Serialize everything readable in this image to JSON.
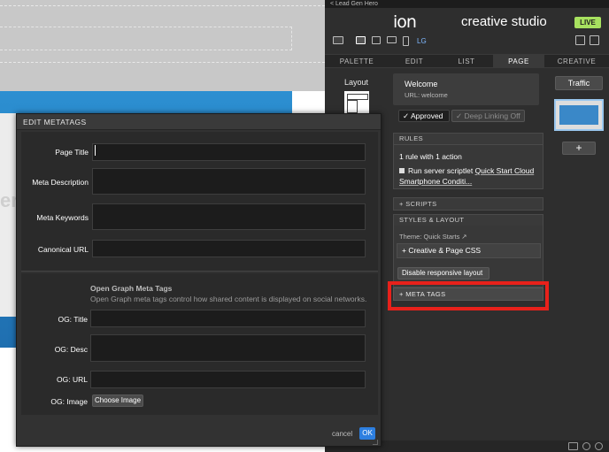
{
  "breadcrumb": "< Lead Gen Hero",
  "app": {
    "logo": "ion",
    "name": "creative studio",
    "live_badge": "LIVE",
    "size_label": "LG"
  },
  "tabs": [
    "PALETTE",
    "EDIT",
    "LIST",
    "PAGE",
    "CREATIVE"
  ],
  "selected_tab": "PAGE",
  "palette": {
    "layout_label": "Layout"
  },
  "page": {
    "title": "Welcome",
    "url": "URL: welcome",
    "approved": "✓ Approved",
    "deep_linking": "✓ Deep Linking Off"
  },
  "rules": {
    "header": "RULES",
    "summary": "1 rule with 1 action",
    "action_prefix": "Run server scriptlet ",
    "action_link": "Quick Start Cloud Smartphone Conditi..."
  },
  "scripts": {
    "header": "+ SCRIPTS"
  },
  "styles": {
    "header": "STYLES & LAYOUT",
    "theme": "Theme: Quick Starts ↗",
    "css": "+ Creative & Page CSS",
    "disable": "Disable responsive layout"
  },
  "metatags_button": "+ META TAGS",
  "creative": {
    "traffic": "Traffic",
    "add": "+"
  },
  "modal": {
    "title": "EDIT METATAGS",
    "fields": {
      "page_title": {
        "label": "Page Title",
        "value": ""
      },
      "meta_description": {
        "label": "Meta Description",
        "value": ""
      },
      "meta_keywords": {
        "label": "Meta Keywords",
        "value": ""
      },
      "canonical_url": {
        "label": "Canonical URL",
        "value": ""
      }
    },
    "og": {
      "heading": "Open Graph Meta Tags",
      "subheading": "Open Graph meta tags control how shared content is displayed on social networks.",
      "title": {
        "label": "OG: Title",
        "value": ""
      },
      "desc": {
        "label": "OG: Desc",
        "value": ""
      },
      "url": {
        "label": "OG: URL",
        "value": ""
      },
      "image": {
        "label": "OG: Image",
        "button": "Choose Image"
      }
    },
    "cancel": "cancel",
    "ok": "OK"
  },
  "colors": {
    "live": "#a7e15f",
    "highlight": "#e8211b",
    "ok": "#2d7fe0"
  }
}
